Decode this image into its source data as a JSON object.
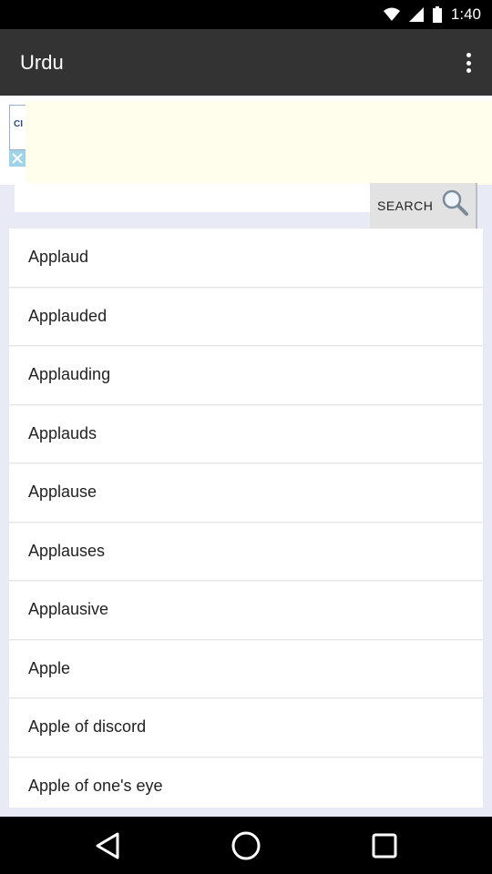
{
  "status_bar": {
    "time": "1:40"
  },
  "app_bar": {
    "title": "Urdu"
  },
  "ad": {
    "snippet": "CI"
  },
  "search": {
    "placeholder": "",
    "value": "",
    "button_label": "SEARCH"
  },
  "words": [
    "Applaud",
    "Applauded",
    "Applauding",
    "Applauds",
    "Applause",
    "Applauses",
    "Applausive",
    "Apple",
    "Apple of discord",
    "Apple of one's eye"
  ],
  "icons": {
    "overflow": "more-vert-icon",
    "search": "magnifier-icon",
    "ad_close": "close-icon",
    "nav_back": "back-triangle-icon",
    "nav_home": "home-circle-icon",
    "nav_recents": "recents-square-icon"
  },
  "colors": {
    "app_bar": "#333333",
    "content_bg": "#e8eaf6",
    "status_bar": "#000000"
  }
}
